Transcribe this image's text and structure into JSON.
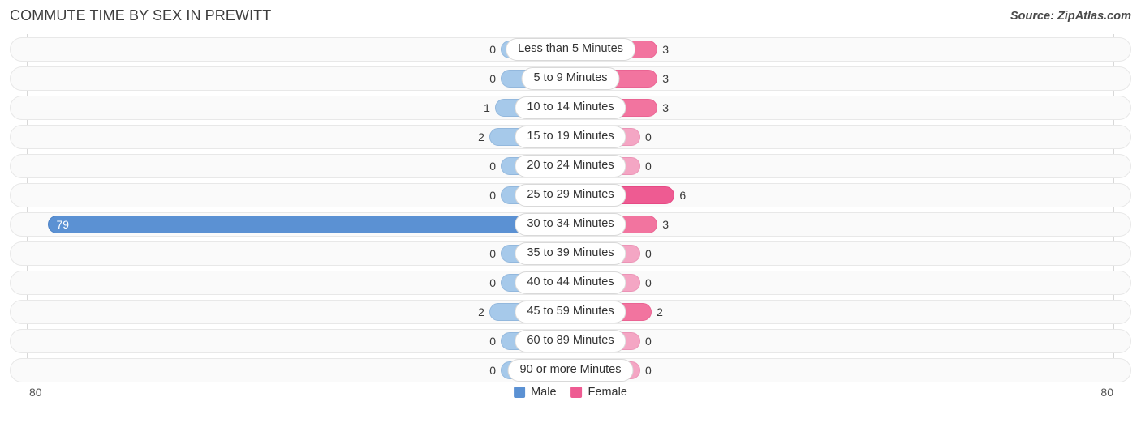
{
  "header": {
    "title": "COMMUTE TIME BY SEX IN PREWITT",
    "source": "Source: ZipAtlas.com"
  },
  "legend": {
    "male_label": "Male",
    "female_label": "Female",
    "male_color": "#5b91d3",
    "female_color": "#ee5b92"
  },
  "axis": {
    "left_tick": "80",
    "right_tick": "80",
    "max": 80
  },
  "chart_data": {
    "type": "bar",
    "title": "COMMUTE TIME BY SEX IN PREWITT",
    "orientation": "horizontal-diverging",
    "xlabel": "",
    "ylabel": "",
    "xlim": [
      0,
      80
    ],
    "grid": false,
    "legend_position": "bottom-center",
    "categories": [
      "Less than 5 Minutes",
      "5 to 9 Minutes",
      "10 to 14 Minutes",
      "15 to 19 Minutes",
      "20 to 24 Minutes",
      "25 to 29 Minutes",
      "30 to 34 Minutes",
      "35 to 39 Minutes",
      "40 to 44 Minutes",
      "45 to 59 Minutes",
      "60 to 89 Minutes",
      "90 or more Minutes"
    ],
    "series": [
      {
        "name": "Male",
        "values": [
          0,
          0,
          1,
          2,
          0,
          0,
          79,
          0,
          0,
          2,
          0,
          0
        ]
      },
      {
        "name": "Female",
        "values": [
          3,
          3,
          3,
          0,
          0,
          6,
          3,
          0,
          0,
          2,
          0,
          0
        ]
      }
    ]
  },
  "rows": [
    {
      "category": "Less than 5 Minutes",
      "male": "0",
      "female": "3"
    },
    {
      "category": "5 to 9 Minutes",
      "male": "0",
      "female": "3"
    },
    {
      "category": "10 to 14 Minutes",
      "male": "1",
      "female": "3"
    },
    {
      "category": "15 to 19 Minutes",
      "male": "2",
      "female": "0"
    },
    {
      "category": "20 to 24 Minutes",
      "male": "0",
      "female": "0"
    },
    {
      "category": "25 to 29 Minutes",
      "male": "0",
      "female": "6"
    },
    {
      "category": "30 to 34 Minutes",
      "male": "79",
      "female": "3"
    },
    {
      "category": "35 to 39 Minutes",
      "male": "0",
      "female": "0"
    },
    {
      "category": "40 to 44 Minutes",
      "male": "0",
      "female": "0"
    },
    {
      "category": "45 to 59 Minutes",
      "male": "2",
      "female": "2"
    },
    {
      "category": "60 to 89 Minutes",
      "male": "0",
      "female": "0"
    },
    {
      "category": "90 or more Minutes",
      "male": "0",
      "female": "0"
    }
  ]
}
